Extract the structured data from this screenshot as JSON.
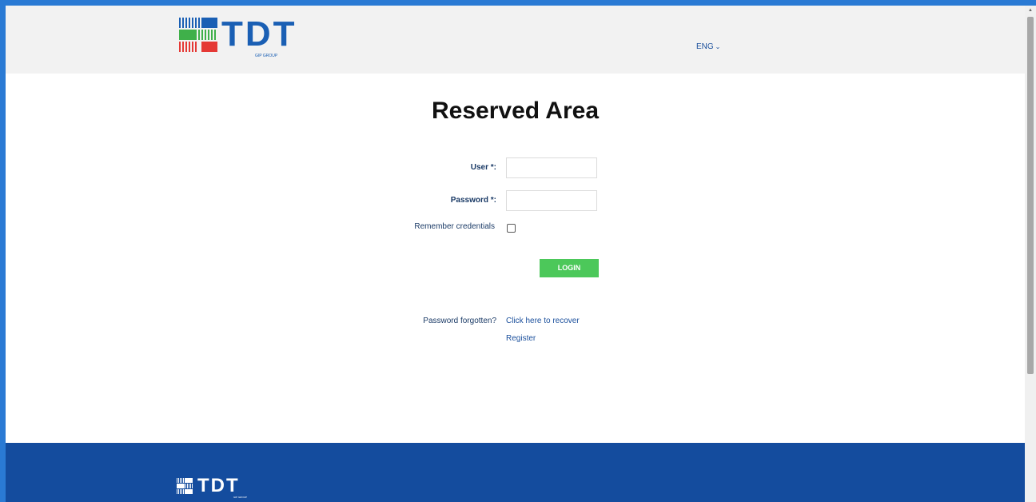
{
  "header": {
    "logo_text": "TDT",
    "logo_sub": "GIP GROUP",
    "language": "ENG"
  },
  "main": {
    "title": "Reserved Area",
    "user_label": "User *:",
    "password_label": "Password *:",
    "remember_label": "Remember credentials",
    "login_label": "LOGIN",
    "forgot_label": "Password forgotten?",
    "recover_link": "Click here to recover",
    "register_link": "Register"
  },
  "footer": {
    "logo_text": "TDT",
    "logo_sub": "GIP GROUP"
  },
  "colors": {
    "brand_blue": "#1a5fb4",
    "footer_blue": "#144c9e",
    "login_green": "#4cc85a",
    "logo_green": "#3fb04a",
    "logo_red": "#e53935"
  },
  "icons": [
    "tdt-logo-icon",
    "chevron-down-icon",
    "checkbox-icon"
  ]
}
